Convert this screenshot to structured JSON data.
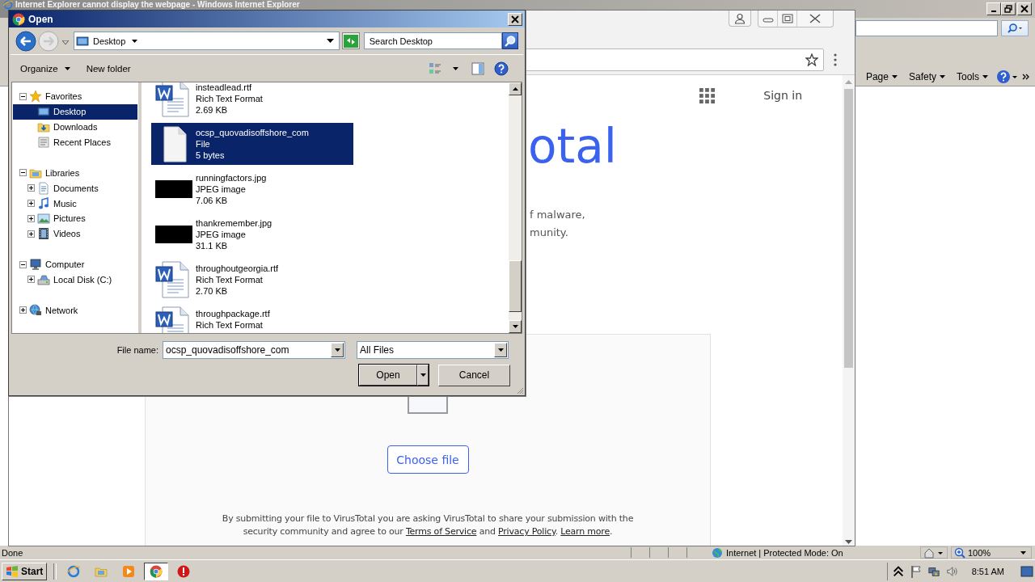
{
  "ie_window": {
    "title": "Internet Explorer cannot display the webpage - Windows Internet Explorer",
    "command_bar": [
      {
        "label": "Page"
      },
      {
        "label": "Safety"
      },
      {
        "label": "Tools"
      }
    ],
    "status_bar": {
      "status": "Done",
      "zone": "Internet | Protected Mode: On",
      "zoom": "100%"
    }
  },
  "chrome_window": {
    "sign_in": "Sign in",
    "heading": "otal",
    "description": [
      "f malware,",
      "munity."
    ],
    "choose_file": "Choose file",
    "notice": [
      {
        "kind": "text",
        "text": "By submitting your file to VirusTotal you are asking VirusTotal to share your submission with the security community and agree to our "
      },
      {
        "kind": "link",
        "text": "Terms of Service"
      },
      {
        "kind": "text",
        "text": " and "
      },
      {
        "kind": "link",
        "text": "Privacy Policy"
      },
      {
        "kind": "text",
        "text": ". "
      },
      {
        "kind": "link",
        "text": "Learn more"
      },
      {
        "kind": "text",
        "text": "."
      }
    ]
  },
  "open_dialog": {
    "title": "Open",
    "location": "Desktop",
    "search": {
      "placeholder": "Search Desktop"
    },
    "toolbar": [
      {
        "label": "Organize",
        "kind": "menu"
      },
      {
        "label": "New folder",
        "kind": "button"
      }
    ],
    "nav_tree": [
      {
        "label": "Favorites",
        "kind": "star",
        "expanded": true,
        "selected": false,
        "children": [
          {
            "label": "Desktop",
            "kind": "desktop",
            "selected": true
          },
          {
            "label": "Downloads",
            "kind": "downloads",
            "selected": false
          },
          {
            "label": "Recent Places",
            "kind": "recent",
            "selected": false
          }
        ]
      },
      {
        "label": "Libraries",
        "kind": "library",
        "expanded": true,
        "selected": false,
        "children": [
          {
            "label": "Documents",
            "kind": "documents",
            "expanded": false,
            "selected": false
          },
          {
            "label": "Music",
            "kind": "music",
            "expanded": false,
            "selected": false
          },
          {
            "label": "Pictures",
            "kind": "pictures",
            "expanded": false,
            "selected": false
          },
          {
            "label": "Videos",
            "kind": "videos",
            "expanded": false,
            "selected": false
          }
        ]
      },
      {
        "label": "Computer",
        "kind": "computer",
        "expanded": true,
        "selected": false,
        "children": [
          {
            "label": "Local Disk (C:)",
            "kind": "disk",
            "expanded": false,
            "selected": false
          }
        ]
      },
      {
        "label": "Network",
        "kind": "network",
        "expanded": false,
        "selected": false
      }
    ],
    "files": [
      {
        "name": "insteadlead.rtf",
        "type": "Rich Text Format",
        "size": "2.69 KB",
        "kind": "rtf",
        "selected": false
      },
      {
        "name": "ocsp_quovadisoffshore_com",
        "type": "File",
        "size": "5 bytes",
        "kind": "file",
        "selected": true
      },
      {
        "name": "runningfactors.jpg",
        "type": "JPEG image",
        "size": "7.06 KB",
        "kind": "jpg",
        "selected": false
      },
      {
        "name": "thankremember.jpg",
        "type": "JPEG image",
        "size": "31.1 KB",
        "kind": "jpg",
        "selected": false
      },
      {
        "name": "throughoutgeorgia.rtf",
        "type": "Rich Text Format",
        "size": "2.70 KB",
        "kind": "rtf",
        "selected": false
      },
      {
        "name": "throughpackage.rtf",
        "type": "Rich Text Format",
        "kind": "rtf",
        "selected": false
      }
    ],
    "file_name_label": "File name:",
    "file_name": "ocsp_quovadisoffshore_com",
    "file_type": "All Files",
    "buttons": [
      {
        "label": "Open",
        "kind": "split"
      },
      {
        "label": "Cancel",
        "kind": "plain"
      }
    ]
  },
  "taskbar": {
    "start": "Start",
    "items": [
      {
        "kind": "ie",
        "selected": false
      },
      {
        "kind": "explorer",
        "selected": false
      },
      {
        "kind": "media",
        "selected": false
      },
      {
        "kind": "chrome",
        "selected": true
      },
      {
        "kind": "stop",
        "selected": false
      }
    ],
    "clock": "8:51 AM"
  }
}
